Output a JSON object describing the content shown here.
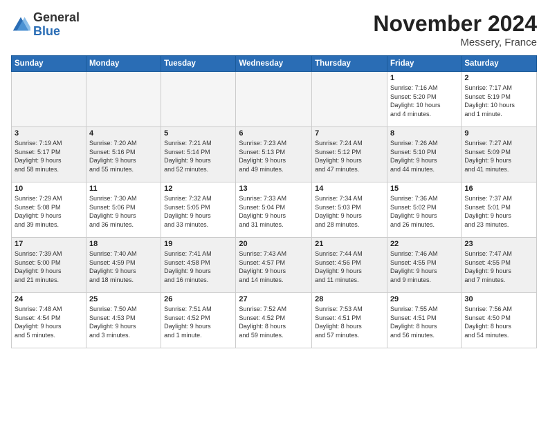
{
  "logo": {
    "general": "General",
    "blue": "Blue"
  },
  "title": "November 2024",
  "location": "Messery, France",
  "days_header": [
    "Sunday",
    "Monday",
    "Tuesday",
    "Wednesday",
    "Thursday",
    "Friday",
    "Saturday"
  ],
  "weeks": [
    [
      {
        "num": "",
        "info": "",
        "empty": true
      },
      {
        "num": "",
        "info": "",
        "empty": true
      },
      {
        "num": "",
        "info": "",
        "empty": true
      },
      {
        "num": "",
        "info": "",
        "empty": true
      },
      {
        "num": "",
        "info": "",
        "empty": true
      },
      {
        "num": "1",
        "info": "Sunrise: 7:16 AM\nSunset: 5:20 PM\nDaylight: 10 hours\nand 4 minutes."
      },
      {
        "num": "2",
        "info": "Sunrise: 7:17 AM\nSunset: 5:19 PM\nDaylight: 10 hours\nand 1 minute."
      }
    ],
    [
      {
        "num": "3",
        "info": "Sunrise: 7:19 AM\nSunset: 5:17 PM\nDaylight: 9 hours\nand 58 minutes.",
        "shaded": true
      },
      {
        "num": "4",
        "info": "Sunrise: 7:20 AM\nSunset: 5:16 PM\nDaylight: 9 hours\nand 55 minutes.",
        "shaded": true
      },
      {
        "num": "5",
        "info": "Sunrise: 7:21 AM\nSunset: 5:14 PM\nDaylight: 9 hours\nand 52 minutes.",
        "shaded": true
      },
      {
        "num": "6",
        "info": "Sunrise: 7:23 AM\nSunset: 5:13 PM\nDaylight: 9 hours\nand 49 minutes.",
        "shaded": true
      },
      {
        "num": "7",
        "info": "Sunrise: 7:24 AM\nSunset: 5:12 PM\nDaylight: 9 hours\nand 47 minutes.",
        "shaded": true
      },
      {
        "num": "8",
        "info": "Sunrise: 7:26 AM\nSunset: 5:10 PM\nDaylight: 9 hours\nand 44 minutes.",
        "shaded": true
      },
      {
        "num": "9",
        "info": "Sunrise: 7:27 AM\nSunset: 5:09 PM\nDaylight: 9 hours\nand 41 minutes.",
        "shaded": true
      }
    ],
    [
      {
        "num": "10",
        "info": "Sunrise: 7:29 AM\nSunset: 5:08 PM\nDaylight: 9 hours\nand 39 minutes."
      },
      {
        "num": "11",
        "info": "Sunrise: 7:30 AM\nSunset: 5:06 PM\nDaylight: 9 hours\nand 36 minutes."
      },
      {
        "num": "12",
        "info": "Sunrise: 7:32 AM\nSunset: 5:05 PM\nDaylight: 9 hours\nand 33 minutes."
      },
      {
        "num": "13",
        "info": "Sunrise: 7:33 AM\nSunset: 5:04 PM\nDaylight: 9 hours\nand 31 minutes."
      },
      {
        "num": "14",
        "info": "Sunrise: 7:34 AM\nSunset: 5:03 PM\nDaylight: 9 hours\nand 28 minutes."
      },
      {
        "num": "15",
        "info": "Sunrise: 7:36 AM\nSunset: 5:02 PM\nDaylight: 9 hours\nand 26 minutes."
      },
      {
        "num": "16",
        "info": "Sunrise: 7:37 AM\nSunset: 5:01 PM\nDaylight: 9 hours\nand 23 minutes."
      }
    ],
    [
      {
        "num": "17",
        "info": "Sunrise: 7:39 AM\nSunset: 5:00 PM\nDaylight: 9 hours\nand 21 minutes.",
        "shaded": true
      },
      {
        "num": "18",
        "info": "Sunrise: 7:40 AM\nSunset: 4:59 PM\nDaylight: 9 hours\nand 18 minutes.",
        "shaded": true
      },
      {
        "num": "19",
        "info": "Sunrise: 7:41 AM\nSunset: 4:58 PM\nDaylight: 9 hours\nand 16 minutes.",
        "shaded": true
      },
      {
        "num": "20",
        "info": "Sunrise: 7:43 AM\nSunset: 4:57 PM\nDaylight: 9 hours\nand 14 minutes.",
        "shaded": true
      },
      {
        "num": "21",
        "info": "Sunrise: 7:44 AM\nSunset: 4:56 PM\nDaylight: 9 hours\nand 11 minutes.",
        "shaded": true
      },
      {
        "num": "22",
        "info": "Sunrise: 7:46 AM\nSunset: 4:55 PM\nDaylight: 9 hours\nand 9 minutes.",
        "shaded": true
      },
      {
        "num": "23",
        "info": "Sunrise: 7:47 AM\nSunset: 4:55 PM\nDaylight: 9 hours\nand 7 minutes.",
        "shaded": true
      }
    ],
    [
      {
        "num": "24",
        "info": "Sunrise: 7:48 AM\nSunset: 4:54 PM\nDaylight: 9 hours\nand 5 minutes."
      },
      {
        "num": "25",
        "info": "Sunrise: 7:50 AM\nSunset: 4:53 PM\nDaylight: 9 hours\nand 3 minutes."
      },
      {
        "num": "26",
        "info": "Sunrise: 7:51 AM\nSunset: 4:52 PM\nDaylight: 9 hours\nand 1 minute."
      },
      {
        "num": "27",
        "info": "Sunrise: 7:52 AM\nSunset: 4:52 PM\nDaylight: 8 hours\nand 59 minutes."
      },
      {
        "num": "28",
        "info": "Sunrise: 7:53 AM\nSunset: 4:51 PM\nDaylight: 8 hours\nand 57 minutes."
      },
      {
        "num": "29",
        "info": "Sunrise: 7:55 AM\nSunset: 4:51 PM\nDaylight: 8 hours\nand 56 minutes."
      },
      {
        "num": "30",
        "info": "Sunrise: 7:56 AM\nSunset: 4:50 PM\nDaylight: 8 hours\nand 54 minutes."
      }
    ]
  ]
}
